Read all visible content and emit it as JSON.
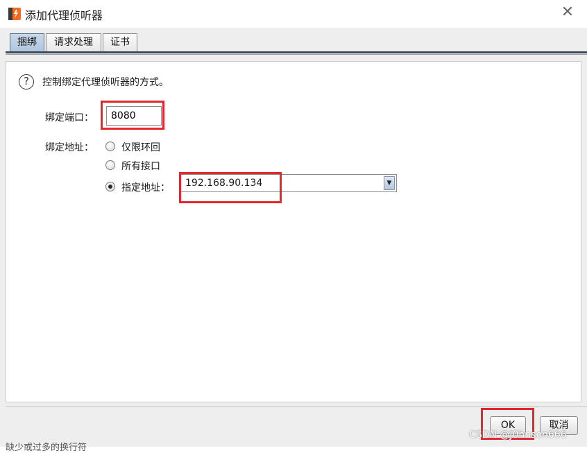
{
  "window": {
    "title": "添加代理侦听器",
    "close_glyph": "✕"
  },
  "tabs": [
    {
      "label": "捆绑",
      "active": true
    },
    {
      "label": "请求处理",
      "active": false
    },
    {
      "label": "证书",
      "active": false
    }
  ],
  "binding": {
    "help_glyph": "?",
    "description": "控制绑定代理侦听器的方式。",
    "port_label": "绑定端口：",
    "port_value": "8080",
    "address_label": "绑定地址：",
    "options": [
      {
        "label": "仅限环回",
        "checked": false
      },
      {
        "label": "所有接口",
        "checked": false
      },
      {
        "label": "指定地址：",
        "checked": true
      }
    ],
    "specified_address": "192.168.90.134",
    "dropdown_glyph": "▼"
  },
  "buttons": {
    "ok": "OK",
    "cancel": "取消"
  },
  "footer": {
    "partial_text": "缺少或过多的换行符",
    "watermark": "CSDN @J0hnson666"
  },
  "colors": {
    "highlight": "#e3262b",
    "accent": "#f26b21"
  }
}
